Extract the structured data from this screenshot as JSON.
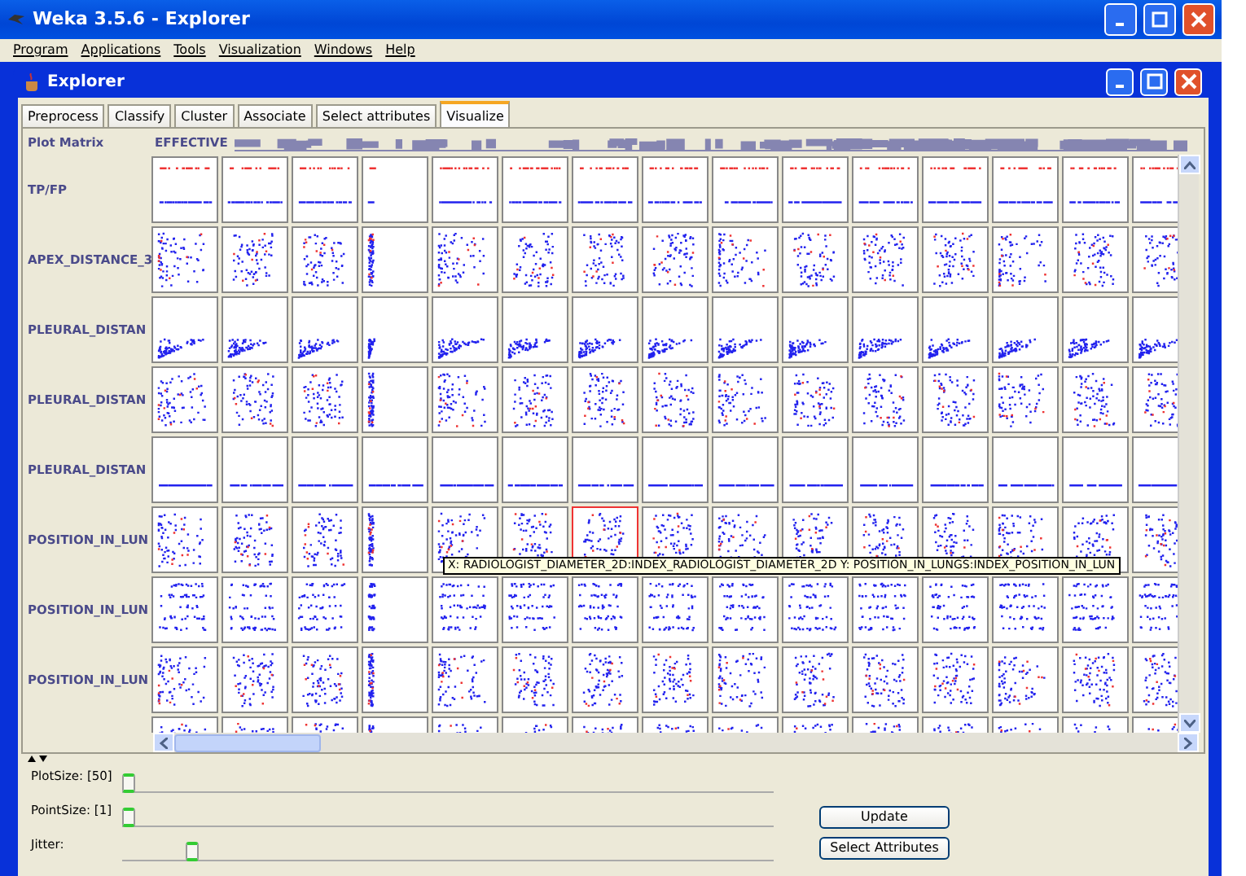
{
  "window": {
    "title": "Weka 3.5.6 - Explorer"
  },
  "menu": [
    "Program",
    "Applications",
    "Tools",
    "Visualization",
    "Windows",
    "Help"
  ],
  "inner_window": {
    "title": "Explorer"
  },
  "tabs": [
    {
      "label": "Preprocess",
      "selected": false
    },
    {
      "label": "Classify",
      "selected": false
    },
    {
      "label": "Cluster",
      "selected": false
    },
    {
      "label": "Associate",
      "selected": false
    },
    {
      "label": "Select attributes",
      "selected": false
    },
    {
      "label": "Visualize",
      "selected": true
    }
  ],
  "plot_matrix": {
    "title": "Plot Matrix",
    "first_column_label": "EFFECTIVE",
    "rows": [
      {
        "label": "TP/FP",
        "kind": "class",
        "cells": [
          {
            "selected": false
          },
          {
            "selected": false
          },
          {
            "selected": false
          },
          {
            "selected": false
          },
          {
            "selected": false
          },
          {
            "selected": false
          },
          {
            "selected": false
          },
          {
            "selected": false
          },
          {
            "selected": false
          },
          {
            "selected": false
          },
          {
            "selected": false
          },
          {
            "selected": false
          },
          {
            "selected": false
          },
          {
            "selected": false
          },
          {
            "selected": false
          }
        ]
      },
      {
        "label": "APEX_DISTANCE_3",
        "kind": "spread",
        "cells": [
          {
            "selected": false
          },
          {
            "selected": false
          },
          {
            "selected": false
          },
          {
            "selected": false
          },
          {
            "selected": false
          },
          {
            "selected": false
          },
          {
            "selected": false
          },
          {
            "selected": false
          },
          {
            "selected": false
          },
          {
            "selected": false
          },
          {
            "selected": false
          },
          {
            "selected": false
          },
          {
            "selected": false
          },
          {
            "selected": false
          },
          {
            "selected": false
          }
        ]
      },
      {
        "label": "PLEURAL_DISTAN",
        "kind": "low",
        "cells": [
          {
            "selected": false
          },
          {
            "selected": false
          },
          {
            "selected": false
          },
          {
            "selected": false
          },
          {
            "selected": false
          },
          {
            "selected": false
          },
          {
            "selected": false
          },
          {
            "selected": false
          },
          {
            "selected": false
          },
          {
            "selected": false
          },
          {
            "selected": false
          },
          {
            "selected": false
          },
          {
            "selected": false
          },
          {
            "selected": false
          },
          {
            "selected": false
          }
        ]
      },
      {
        "label": "PLEURAL_DISTAN",
        "kind": "spread",
        "cells": [
          {
            "selected": false
          },
          {
            "selected": false
          },
          {
            "selected": false
          },
          {
            "selected": false
          },
          {
            "selected": false
          },
          {
            "selected": false
          },
          {
            "selected": false
          },
          {
            "selected": false
          },
          {
            "selected": false
          },
          {
            "selected": false
          },
          {
            "selected": false
          },
          {
            "selected": false
          },
          {
            "selected": false
          },
          {
            "selected": false
          },
          {
            "selected": false
          }
        ]
      },
      {
        "label": "PLEURAL_DISTAN",
        "kind": "flat",
        "cells": [
          {
            "selected": false
          },
          {
            "selected": false
          },
          {
            "selected": false
          },
          {
            "selected": false
          },
          {
            "selected": false
          },
          {
            "selected": false
          },
          {
            "selected": false
          },
          {
            "selected": false
          },
          {
            "selected": false
          },
          {
            "selected": false
          },
          {
            "selected": false
          },
          {
            "selected": false
          },
          {
            "selected": false
          },
          {
            "selected": false
          },
          {
            "selected": false
          }
        ]
      },
      {
        "label": "POSITION_IN_LUN",
        "kind": "spread",
        "cells": [
          {
            "selected": false
          },
          {
            "selected": false
          },
          {
            "selected": false
          },
          {
            "selected": false
          },
          {
            "selected": false
          },
          {
            "selected": false
          },
          {
            "selected": true
          },
          {
            "selected": false
          },
          {
            "selected": false
          },
          {
            "selected": false
          },
          {
            "selected": false
          },
          {
            "selected": false
          },
          {
            "selected": false
          },
          {
            "selected": false
          },
          {
            "selected": false
          }
        ]
      },
      {
        "label": "POSITION_IN_LUN",
        "kind": "bands",
        "cells": [
          {
            "selected": false
          },
          {
            "selected": false
          },
          {
            "selected": false
          },
          {
            "selected": false
          },
          {
            "selected": false
          },
          {
            "selected": false
          },
          {
            "selected": false
          },
          {
            "selected": false
          },
          {
            "selected": false
          },
          {
            "selected": false
          },
          {
            "selected": false
          },
          {
            "selected": false
          },
          {
            "selected": false
          },
          {
            "selected": false
          },
          {
            "selected": false
          }
        ]
      },
      {
        "label": "POSITION_IN_LUN",
        "kind": "spread",
        "cells": [
          {
            "selected": false
          },
          {
            "selected": false
          },
          {
            "selected": false
          },
          {
            "selected": false
          },
          {
            "selected": false
          },
          {
            "selected": false
          },
          {
            "selected": false
          },
          {
            "selected": false
          },
          {
            "selected": false
          },
          {
            "selected": false
          },
          {
            "selected": false
          },
          {
            "selected": false
          },
          {
            "selected": false
          },
          {
            "selected": false
          },
          {
            "selected": false
          }
        ]
      },
      {
        "kind": "spread",
        "cells": [
          {
            "selected": false
          },
          {
            "selected": false
          },
          {
            "selected": false
          },
          {
            "selected": false
          },
          {
            "selected": false
          },
          {
            "selected": false
          },
          {
            "selected": false
          },
          {
            "selected": false
          },
          {
            "selected": false
          },
          {
            "selected": false
          },
          {
            "selected": false
          },
          {
            "selected": false
          },
          {
            "selected": false
          },
          {
            "selected": false
          },
          {
            "selected": false
          }
        ]
      }
    ],
    "tooltip": "X: RADIOLOGIST_DIAMETER_2D:INDEX_RADIOLOGIST_DIAMETER_2D Y: POSITION_IN_LUNGS:INDEX_POSITION_IN_LUN"
  },
  "controls": [
    {
      "label": "PlotSize: [50]",
      "level": 0.0
    },
    {
      "label": "PointSize: [1]",
      "level": 0.0
    },
    {
      "label": "Jitter:",
      "level": 0.1
    }
  ],
  "buttons": [
    "Update",
    "Select Attributes"
  ]
}
